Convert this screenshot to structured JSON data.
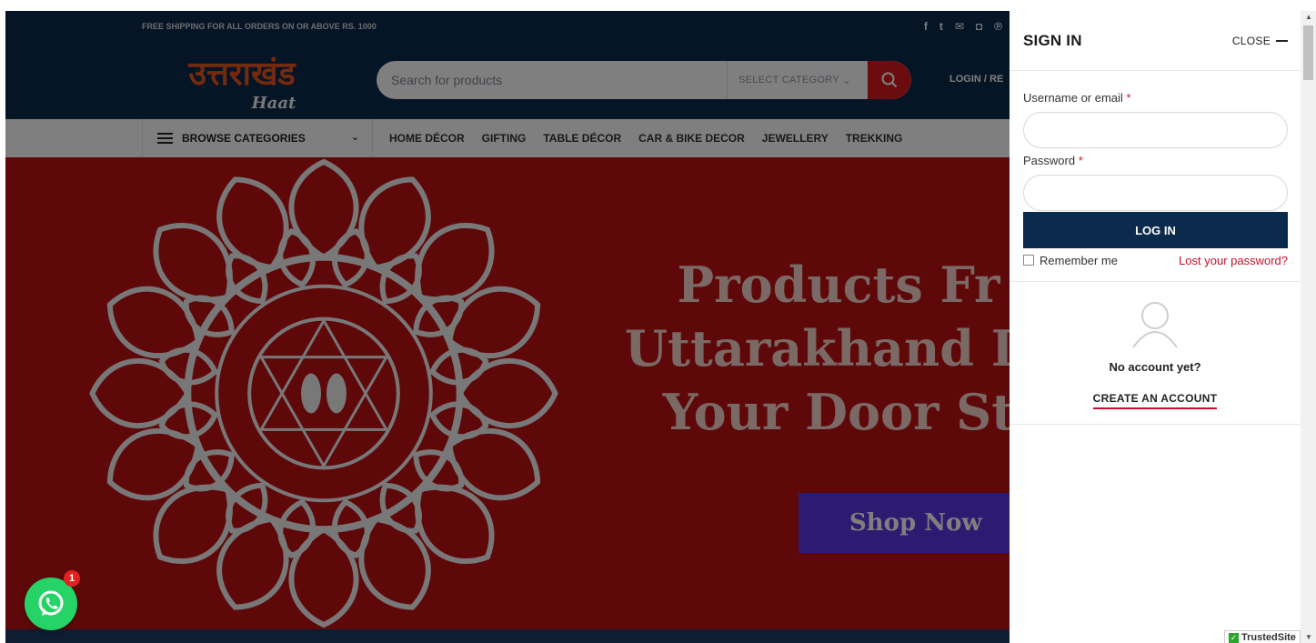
{
  "topbar": {
    "shipping_text": "FREE SHIPPING FOR ALL ORDERS ON OR ABOVE RS. 1000",
    "social_icons": [
      "facebook-icon",
      "twitter-icon",
      "email-icon",
      "instagram-icon",
      "pinterest-icon"
    ]
  },
  "header": {
    "logo_text_hindi": "उत्तराखंड",
    "logo_text_sub": "Haat",
    "search_placeholder": "Search for products",
    "category_select": "SELECT CATEGORY",
    "login_link": "LOGIN / RE"
  },
  "nav": {
    "browse_label": "BROWSE CATEGORIES",
    "items": [
      "HOME DÉCOR",
      "GIFTING",
      "TABLE DÉCOR",
      "CAR & BIKE DECOR",
      "JEWELLERY",
      "TREKKING"
    ]
  },
  "hero": {
    "title_line1": "Products Fr",
    "title_line2": "Uttarakhand Di",
    "title_line3": "Your Door St",
    "button_label": "Shop Now"
  },
  "whatsapp": {
    "badge_count": "1"
  },
  "panel": {
    "title": "SIGN IN",
    "close_label": "CLOSE",
    "username_label": "Username or email",
    "password_label": "Password",
    "required_mark": "*",
    "login_button": "LOG IN",
    "remember_label": "Remember me",
    "lost_password": "Lost your password?",
    "no_account": "No account yet?",
    "create_account": "CREATE AN ACCOUNT"
  },
  "badge": {
    "trusted_site": "TrustedSite"
  },
  "colors": {
    "navy": "#0c2a4c",
    "accent_red": "#c8102e",
    "hero_red": "#bf1014",
    "button_purple": "#5a35e3",
    "whatsapp_green": "#25d366"
  }
}
